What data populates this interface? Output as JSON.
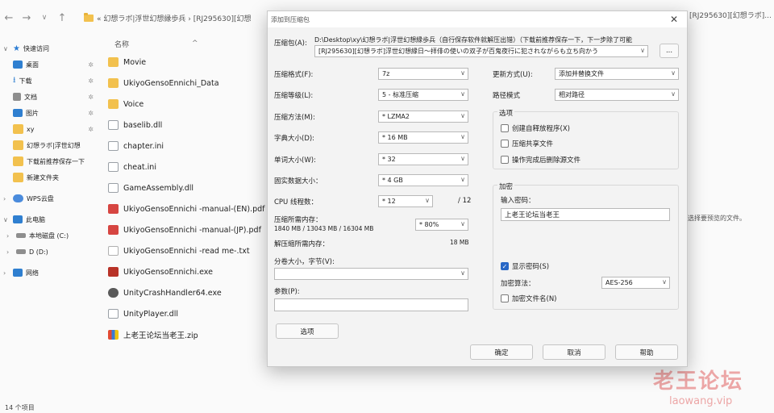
{
  "explorer": {
    "address": "« 幻想ラボ|浮世幻想縁歩兵 › [RJ295630][幻想",
    "address_right": "[RJ295630][幻想ラボ]...",
    "column_name": "名称",
    "sidebar": [
      {
        "label": "快速访问",
        "icon": "star-icon",
        "level": 0
      },
      {
        "label": "桌面",
        "icon": "desktop-icon",
        "level": 1
      },
      {
        "label": "下载",
        "icon": "download-icon",
        "level": 1
      },
      {
        "label": "文档",
        "icon": "document-icon",
        "level": 1
      },
      {
        "label": "图片",
        "icon": "picture-icon",
        "level": 1
      },
      {
        "label": "xy",
        "icon": "folder-icon",
        "level": 1
      },
      {
        "label": "幻想ラボ|浮世幻想",
        "icon": "folder-icon",
        "level": 1
      },
      {
        "label": "下载前推荐保存一下",
        "icon": "folder-icon",
        "level": 1
      },
      {
        "label": "新建文件夹",
        "icon": "folder-icon",
        "level": 1
      },
      {
        "label": "WPS云盘",
        "icon": "cloud-icon",
        "level": 0
      },
      {
        "label": "此电脑",
        "icon": "computer-icon",
        "level": 0
      },
      {
        "label": "本地磁盘 (C:)",
        "icon": "drive-icon",
        "level": 1
      },
      {
        "label": "D (D:)",
        "icon": "drive-icon",
        "level": 1
      },
      {
        "label": "网络",
        "icon": "network-icon",
        "level": 0
      }
    ],
    "files": [
      {
        "name": "Movie",
        "type": "folder"
      },
      {
        "name": "UkiyoGensoEnnichi_Data",
        "type": "folder"
      },
      {
        "name": "Voice",
        "type": "folder"
      },
      {
        "name": "baselib.dll",
        "type": "dll"
      },
      {
        "name": "chapter.ini",
        "type": "ini"
      },
      {
        "name": "cheat.ini",
        "type": "ini"
      },
      {
        "name": "GameAssembly.dll",
        "type": "dll"
      },
      {
        "name": "UkiyoGensoEnnichi -manual-(EN).pdf",
        "type": "pdf"
      },
      {
        "name": "UkiyoGensoEnnichi -manual-(JP).pdf",
        "type": "pdf"
      },
      {
        "name": "UkiyoGensoEnnichi -read me-.txt",
        "type": "txt"
      },
      {
        "name": "UkiyoGensoEnnichi.exe",
        "type": "exe"
      },
      {
        "name": "UnityCrashHandler64.exe",
        "type": "exe2"
      },
      {
        "name": "UnityPlayer.dll",
        "type": "dll"
      },
      {
        "name": "上老王论坛当老王.zip",
        "type": "zip"
      }
    ],
    "status": "14 个项目",
    "right_hint": "选择要预览的文件。"
  },
  "dialog": {
    "title": "添加到压缩包",
    "archive_label": "压缩包(A):",
    "archive_path": "D:\\Desktop\\xy\\幻想ラボ|浮世幻想縁歩兵（自行保存软件就解压出错）（下载前推荐保存一下，下一步除了可能",
    "archive_value": "[RJ295630][幻想ラボ]浮世幻想縁日～拝俳の使いの双子が百鬼夜行に犯されながらも立ち向かう",
    "browse_label": "...",
    "format_label": "压缩格式(F):",
    "format_value": "7z",
    "level_label": "压缩等级(L):",
    "level_value": "5 - 标准压缩",
    "method_label": "压缩方法(M):",
    "method_value": "* LZMA2",
    "dict_label": "字典大小(D):",
    "dict_value": "* 16 MB",
    "word_label": "单词大小(W):",
    "word_value": "* 32",
    "solid_label": "固实数据大小：",
    "solid_value": "* 4 GB",
    "cpu_label": "CPU 线程数：",
    "cpu_value": "* 12",
    "cpu_total": "/ 12",
    "mem_label": "压缩所需内存：",
    "mem_detail": "1840 MB / 13043 MB / 16304 MB",
    "mem_percent": "* 80%",
    "unpack_label": "解压缩所需内存：",
    "unpack_value": "18 MB",
    "split_label": "分卷大小，字节(V):",
    "split_value": "",
    "params_label": "参数(P):",
    "params_value": "",
    "options_btn": "选项",
    "update_label": "更新方式(U):",
    "update_value": "添加并替换文件",
    "path_label": "路径模式",
    "path_value": "相对路径",
    "options_group": "选项",
    "opt_sfx": "创建自释放程序(X)",
    "opt_shared": "压缩共享文件",
    "opt_delete": "操作完成后删除源文件",
    "encrypt_group": "加密",
    "password_label": "输入密码：",
    "password_value": "上老王论坛当老王",
    "show_password": "显示密码(S)",
    "enc_method_label": "加密算法：",
    "enc_method_value": "AES-256",
    "encrypt_names": "加密文件名(N)",
    "ok": "确定",
    "cancel": "取消",
    "help": "帮助"
  },
  "watermark": {
    "main": "老王论坛",
    "url": "laowang.vip"
  }
}
